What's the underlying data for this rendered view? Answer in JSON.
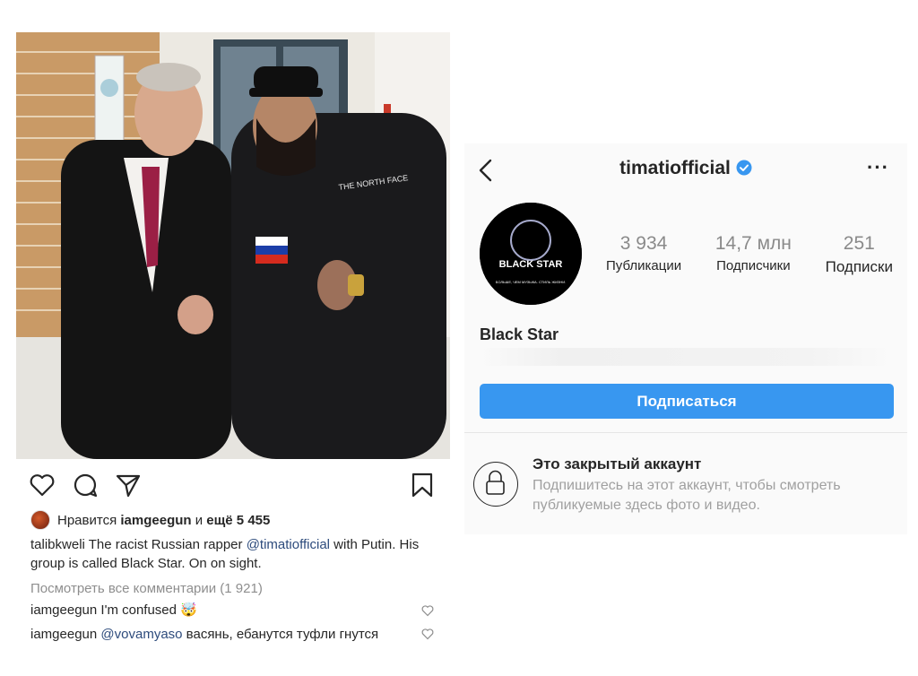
{
  "post": {
    "likes": {
      "prefix": "Нравится",
      "user": "iamgeegun",
      "joiner": "и",
      "rest": "ещё 5 455"
    },
    "caption": {
      "user": "talibkweli",
      "text_before": "The racist Russian rapper",
      "mention": "@timatiofficial",
      "text_after": "with Putin. His group is called Black Star. On on sight."
    },
    "view_comments": "Посмотреть все комментарии (1 921)",
    "comments": [
      {
        "user": "iamgeegun",
        "text": "I'm confused",
        "emoji": "🤯"
      },
      {
        "user": "iamgeegun",
        "mention": "@vovamyaso",
        "text": "васянь, ебанутся туфли гнутся"
      }
    ],
    "icons": [
      "heart-icon",
      "comment-icon",
      "share-icon",
      "bookmark-icon"
    ],
    "flag_colors": [
      "#ffffff",
      "#1c3ea8",
      "#d52b1e"
    ]
  },
  "profile": {
    "username": "timatiofficial",
    "verified": true,
    "more": "···",
    "avatar_text": {
      "brand": "BLACK STAR",
      "tagline": "БОЛЬШЕ, ЧЕМ МУЗЫКА. СТИЛЬ ЖИЗНИ."
    },
    "stats": [
      {
        "value": "3 934",
        "label": "Публикации"
      },
      {
        "value": "14,7 млн",
        "label": "Подписчики"
      },
      {
        "value": "251",
        "label": "Подписки"
      }
    ],
    "display_name": "Black Star",
    "follow_button": "Подписаться",
    "private": {
      "title": "Это закрытый аккаунт",
      "text": "Подпишитесь на этот аккаунт, чтобы смотреть публикуемые здесь фото и видео."
    },
    "accent": "#3897f0"
  }
}
